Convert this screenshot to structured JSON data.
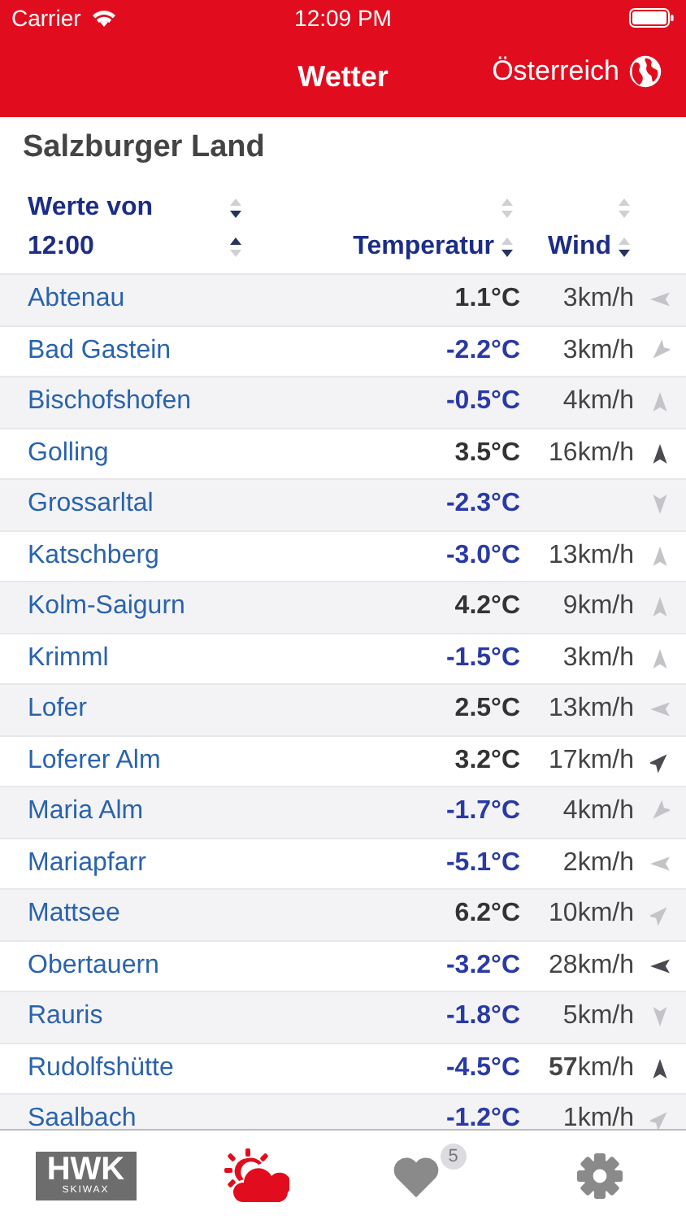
{
  "status_bar": {
    "carrier": "Carrier",
    "time": "12:09 PM"
  },
  "nav_bar": {
    "title": "Wetter",
    "region_button": "Österreich"
  },
  "section_title": "Salzburger Land",
  "table": {
    "header_rows": [
      [
        {
          "label": "Werte von",
          "up_active": false,
          "down_active": true
        },
        {
          "up_active": false,
          "down_active": false
        },
        {
          "up_active": false,
          "down_active": false
        }
      ],
      [
        {
          "label": "12:00",
          "up_active": true,
          "down_active": false
        },
        {
          "label": "Temperatur",
          "up_active": false,
          "down_active": true
        },
        {
          "label": "Wind",
          "up_active": false,
          "down_active": true
        }
      ]
    ],
    "rows": [
      {
        "name": "Abtenau",
        "temperature": "1.1°C",
        "freezing": false,
        "wind": "3km/h",
        "arrow": {
          "kind": "west",
          "dark": false
        }
      },
      {
        "name": "Bad Gastein",
        "temperature": "-2.2°C",
        "freezing": true,
        "wind": "3km/h",
        "arrow": {
          "kind": "southwest",
          "dark": false
        }
      },
      {
        "name": "Bischofshofen",
        "temperature": "-0.5°C",
        "freezing": true,
        "wind": "4km/h",
        "arrow": {
          "kind": "north",
          "dark": false
        }
      },
      {
        "name": "Golling",
        "temperature": "3.5°C",
        "freezing": false,
        "wind": "16km/h",
        "arrow": {
          "kind": "north",
          "dark": true
        }
      },
      {
        "name": "Grossarltal",
        "temperature": "-2.3°C",
        "freezing": true,
        "arrow": {
          "kind": "south",
          "dark": false
        }
      },
      {
        "name": "Katschberg",
        "temperature": "-3.0°C",
        "freezing": true,
        "wind": "13km/h",
        "arrow": {
          "kind": "north",
          "dark": false
        }
      },
      {
        "name": "Kolm-Saigurn",
        "temperature": "4.2°C",
        "freezing": false,
        "wind": "9km/h",
        "arrow": {
          "kind": "north",
          "dark": false
        }
      },
      {
        "name": "Krimml",
        "temperature": "-1.5°C",
        "freezing": true,
        "wind": "3km/h",
        "arrow": {
          "kind": "north",
          "dark": false
        }
      },
      {
        "name": "Lofer",
        "temperature": "2.5°C",
        "freezing": false,
        "wind": "13km/h",
        "arrow": {
          "kind": "west",
          "dark": false
        }
      },
      {
        "name": "Loferer Alm",
        "temperature": "3.2°C",
        "freezing": false,
        "wind": "17km/h",
        "arrow": {
          "kind": "northeast",
          "dark": true
        }
      },
      {
        "name": "Maria Alm",
        "temperature": "-1.7°C",
        "freezing": true,
        "wind": "4km/h",
        "arrow": {
          "kind": "southwest",
          "dark": false
        }
      },
      {
        "name": "Mariapfarr",
        "temperature": "-5.1°C",
        "freezing": true,
        "wind": "2km/h",
        "arrow": {
          "kind": "west",
          "dark": false
        }
      },
      {
        "name": "Mattsee",
        "temperature": "6.2°C",
        "freezing": false,
        "wind": "10km/h",
        "arrow": {
          "kind": "northeast",
          "dark": false
        }
      },
      {
        "name": "Obertauern",
        "temperature": "-3.2°C",
        "freezing": true,
        "wind": "28km/h",
        "arrow": {
          "kind": "west",
          "dark": true
        }
      },
      {
        "name": "Rauris",
        "temperature": "-1.8°C",
        "freezing": true,
        "wind": "5km/h",
        "arrow": {
          "kind": "south",
          "dark": false
        }
      },
      {
        "name": "Rudolfshütte",
        "temperature": "-4.5°C",
        "freezing": true,
        "wind": "**57**km/h",
        "arrow": {
          "kind": "north",
          "dark": true
        }
      },
      {
        "name": "Saalbach",
        "temperature": "-1.2°C",
        "freezing": true,
        "wind": "1km/h",
        "arrow": {
          "kind": "northeast",
          "dark": false
        }
      }
    ]
  },
  "tab_bar": [
    {
      "kind": "logo",
      "logo_text": "HWK",
      "logo_subtext": "SKIWAX",
      "selected": false
    },
    {
      "kind": "weather",
      "selected": true
    },
    {
      "kind": "favorites",
      "badge": "5",
      "selected": false
    },
    {
      "kind": "settings",
      "selected": false
    }
  ]
}
